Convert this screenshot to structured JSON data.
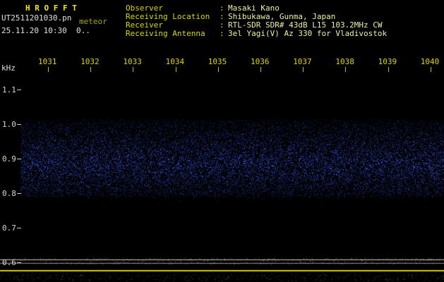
{
  "header": {
    "app_title": "H R O F F T",
    "file_name": "UT2511201030.pn",
    "mode": "meteor",
    "timestamp": "25.11.20 10:30  0..",
    "info": [
      {
        "label": "Observer",
        "value": "Masaki Kano"
      },
      {
        "label": "Receiving Location",
        "value": "Shibukawa, Gunma, Japan"
      },
      {
        "label": "Receiver",
        "value": "RTL-SDR SDR# 43dB L15 103.2MHz CW"
      },
      {
        "label": "Receiving Antenna",
        "value": "3el Yagi(V) Az 330 for Vladivostok"
      }
    ]
  },
  "chart_data": {
    "type": "heatmap",
    "title": "H R O F F T meteor echo spectrogram",
    "ylabel": "kHz",
    "x_ticks": [
      "1031",
      "1032",
      "1033",
      "1034",
      "1035",
      "1036",
      "1037",
      "1038",
      "1039",
      "1040"
    ],
    "y_ticks": [
      "1.1",
      "1.0",
      "0.9",
      "0.8",
      "0.7",
      "0.6"
    ],
    "ylim": [
      0.58,
      1.16
    ],
    "grid": false,
    "legend": false,
    "noise_band": {
      "freq_low_khz": 0.79,
      "freq_high_khz": 1.01,
      "center_khz": 0.885,
      "dot_color_rgb": [
        60,
        90,
        255
      ]
    }
  },
  "colors": {
    "background": "#000000",
    "accent_yellow": "#e8d800",
    "text_white": "#e2e2e2",
    "noise_blue": "#3c5aff",
    "level_trace_white": "#c8c8c8",
    "separator_yellow": "#d0d000"
  }
}
